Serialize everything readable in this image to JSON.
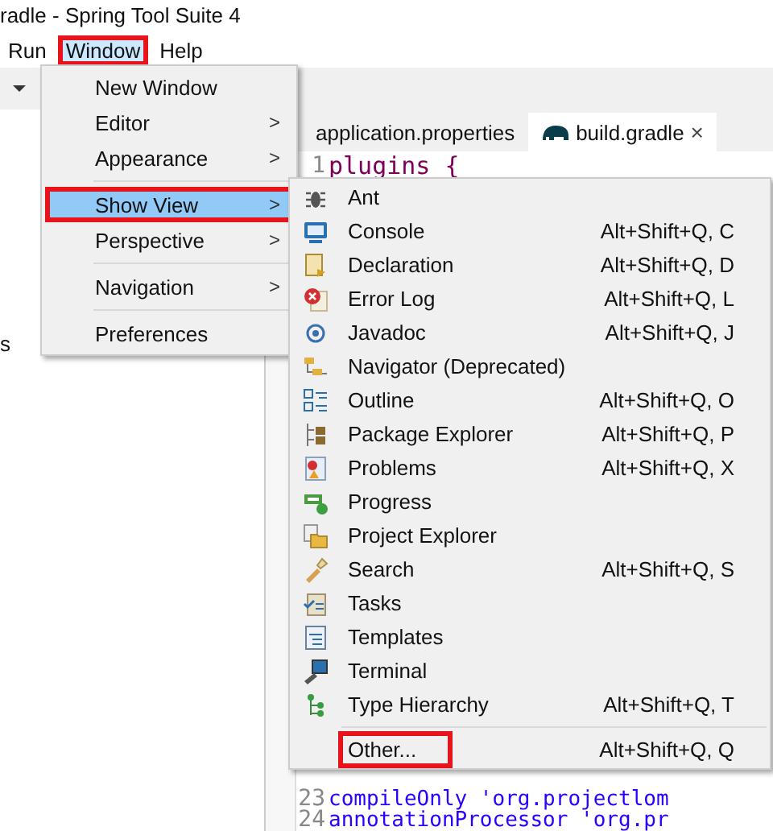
{
  "window": {
    "title": "radle - Spring Tool Suite 4"
  },
  "menu_bar": [
    {
      "label": "Run",
      "selected": false,
      "annotated": false
    },
    {
      "label": "Window",
      "selected": true,
      "annotated": true
    },
    {
      "label": "Help",
      "selected": false,
      "annotated": false
    }
  ],
  "editor_tabs": [
    {
      "label": "application.properties",
      "selected": false,
      "closable": false
    },
    {
      "label": "build.gradle",
      "selected": true,
      "closable": true,
      "close": "×"
    }
  ],
  "left_pane": {
    "text": "s"
  },
  "editor_lines": [
    {
      "number": "1",
      "code": "plugins {"
    },
    {
      "number": "23",
      "code": "compileOnly 'org.projectlom"
    },
    {
      "number": "24",
      "code": "annotationProcessor 'org.pr"
    }
  ],
  "window_menu": [
    {
      "kind": "item",
      "label": "New Window",
      "selected": false,
      "annotated": false
    },
    {
      "kind": "item",
      "label": "Editor",
      "arrow": ">",
      "selected": false,
      "annotated": false
    },
    {
      "kind": "item",
      "label": "Appearance",
      "arrow": ">",
      "selected": false,
      "annotated": false
    },
    {
      "kind": "separator"
    },
    {
      "kind": "item",
      "label": "Show View",
      "arrow": ">",
      "selected": true,
      "annotated": true
    },
    {
      "kind": "item",
      "label": "Perspective",
      "arrow": ">",
      "selected": false,
      "annotated": false
    },
    {
      "kind": "separator"
    },
    {
      "kind": "item",
      "label": "Navigation",
      "arrow": ">",
      "selected": false,
      "annotated": false
    },
    {
      "kind": "separator"
    },
    {
      "kind": "item",
      "label": "Preferences",
      "selected": false,
      "annotated": false
    }
  ],
  "show_view_menu": [
    {
      "label": "Ant",
      "annotated": false
    },
    {
      "label": "Console",
      "shortcut": "Alt+Shift+Q, C",
      "annotated": false
    },
    {
      "label": "Declaration",
      "shortcut": "Alt+Shift+Q, D",
      "annotated": false
    },
    {
      "label": "Error Log",
      "shortcut": "Alt+Shift+Q, L",
      "annotated": false
    },
    {
      "label": "Javadoc",
      "shortcut": "Alt+Shift+Q, J",
      "annotated": false
    },
    {
      "label": "Navigator (Deprecated)",
      "annotated": false
    },
    {
      "label": "Outline",
      "shortcut": "Alt+Shift+Q, O",
      "annotated": false
    },
    {
      "label": "Package Explorer",
      "shortcut": "Alt+Shift+Q, P",
      "annotated": false
    },
    {
      "label": "Problems",
      "shortcut": "Alt+Shift+Q, X",
      "annotated": false
    },
    {
      "label": "Progress",
      "annotated": false
    },
    {
      "label": "Project Explorer",
      "annotated": false
    },
    {
      "label": "Search",
      "shortcut": "Alt+Shift+Q, S",
      "annotated": false
    },
    {
      "label": "Tasks",
      "annotated": false
    },
    {
      "label": "Templates",
      "annotated": false
    },
    {
      "label": "Terminal",
      "annotated": false
    },
    {
      "label": "Type Hierarchy",
      "shortcut": "Alt+Shift+Q, T",
      "annotated": false
    },
    {
      "kind": "separator"
    },
    {
      "label": "Other...",
      "shortcut": "Alt+Shift+Q, Q",
      "annotated": true
    }
  ]
}
